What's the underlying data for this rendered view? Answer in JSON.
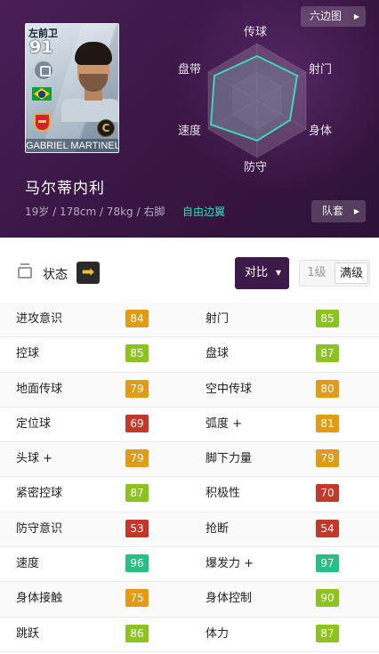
{
  "colors": {
    "header_bg": "#3a1746",
    "accent_teal": "#3ed5b8",
    "compare_bg": "#3e1a4a",
    "stat_red": "#c0392b",
    "stat_orange": "#e19b14",
    "stat_lime": "#8cc31f",
    "stat_green": "#27c084"
  },
  "card": {
    "position": "左前卫",
    "rating": "91",
    "name": "GABRIEL MARTINELL",
    "card_icon": "C",
    "flag_icon": "brazil-flag-icon",
    "club_icon": "arsenal-crest-icon"
  },
  "header": {
    "hex_button": "六边图",
    "player_name": "马尔蒂内利",
    "player_info": "19岁 / 178cm / 78kg / 右脚",
    "player_role": "自由边翼",
    "kit_button": "队套"
  },
  "radar": {
    "labels": {
      "top": "传球",
      "top_right": "射门",
      "bottom_right": "身体",
      "bottom": "防守",
      "bottom_left": "速度",
      "top_left": "盘带"
    }
  },
  "status": {
    "label": "状态",
    "arrow": "➡",
    "compare_button": "对比",
    "level_1": "1级",
    "level_max": "满级"
  },
  "stats": [
    {
      "left": {
        "name": "进攻意识",
        "value": "84",
        "color": "orange"
      },
      "right": {
        "name": "射门",
        "value": "85",
        "color": "lime"
      }
    },
    {
      "left": {
        "name": "控球",
        "value": "85",
        "color": "lime"
      },
      "right": {
        "name": "盘球",
        "value": "87",
        "color": "lime"
      }
    },
    {
      "left": {
        "name": "地面传球",
        "value": "79",
        "color": "orange"
      },
      "right": {
        "name": "空中传球",
        "value": "80",
        "color": "orange"
      }
    },
    {
      "left": {
        "name": "定位球",
        "value": "69",
        "color": "red"
      },
      "right": {
        "name": "弧度 +",
        "value": "81",
        "color": "orange"
      }
    },
    {
      "left": {
        "name": "头球 +",
        "value": "79",
        "color": "orange"
      },
      "right": {
        "name": "脚下力量",
        "value": "79",
        "color": "orange"
      }
    },
    {
      "left": {
        "name": "紧密控球",
        "value": "87",
        "color": "lime"
      },
      "right": {
        "name": "积极性",
        "value": "70",
        "color": "red"
      }
    },
    {
      "left": {
        "name": "防守意识",
        "value": "53",
        "color": "red"
      },
      "right": {
        "name": "抢断",
        "value": "54",
        "color": "red"
      }
    },
    {
      "left": {
        "name": "速度",
        "value": "96",
        "color": "green"
      },
      "right": {
        "name": "爆发力 +",
        "value": "97",
        "color": "green"
      }
    },
    {
      "left": {
        "name": "身体接触",
        "value": "75",
        "color": "orange"
      },
      "right": {
        "name": "身体控制",
        "value": "90",
        "color": "lime"
      }
    },
    {
      "left": {
        "name": "跳跃",
        "value": "86",
        "color": "lime"
      },
      "right": {
        "name": "体力",
        "value": "87",
        "color": "lime"
      }
    }
  ]
}
